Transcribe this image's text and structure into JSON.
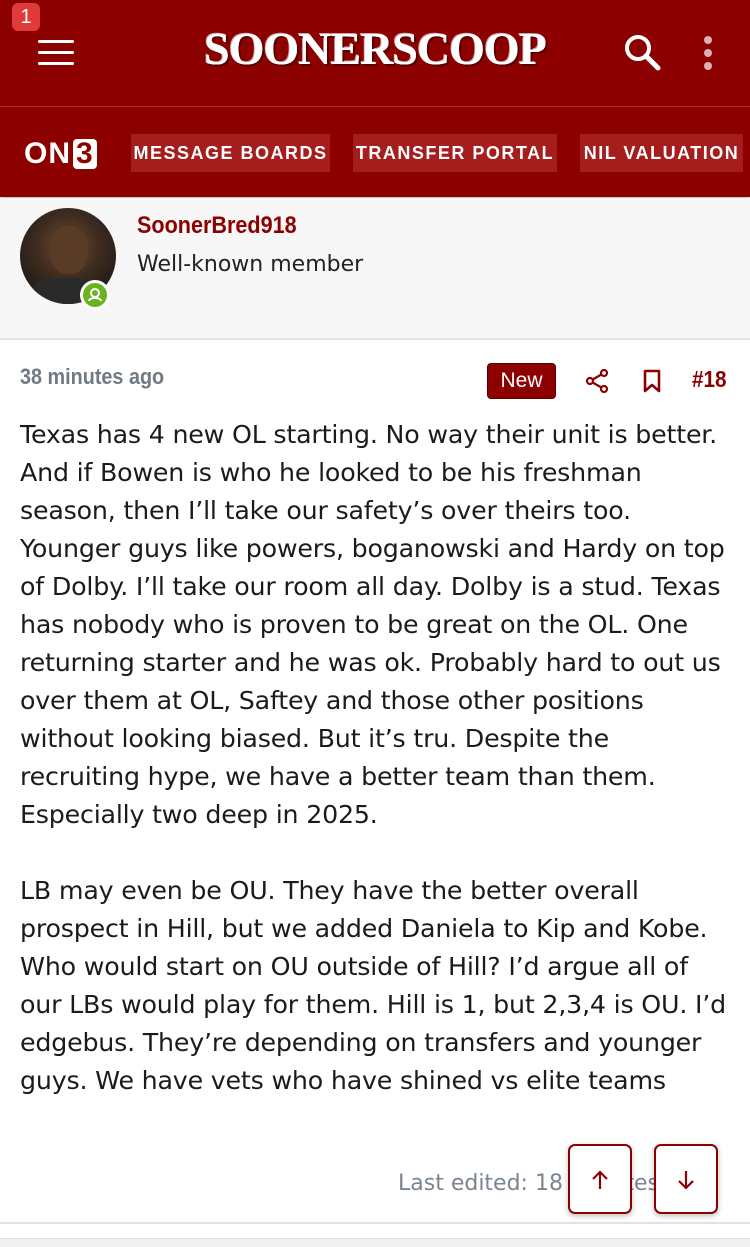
{
  "header": {
    "notification_count": "1",
    "site_name": "SOONERSCOOP"
  },
  "nav": {
    "brand": "ON",
    "brand_suffix": "3",
    "items": [
      {
        "label": "MESSAGE BOARDS"
      },
      {
        "label": "TRANSFER PORTAL"
      },
      {
        "label": "NIL VALUATION"
      }
    ]
  },
  "post": {
    "author": {
      "username": "SoonerBred918",
      "title": "Well-known member",
      "online": true
    },
    "time": "38 minutes ago",
    "new_badge": "New",
    "post_number": "#18",
    "paragraphs": [
      "Texas has 4 new OL starting. No way their unit is better. And if Bowen is who he looked to be his freshman season, then I’ll take our safety’s over theirs too. Younger guys like powers, boganowski and Hardy on top of Dolby. I’ll take our room all day. Dolby is a stud. Texas has nobody who is proven to be great on the OL. One returning starter and he was ok. Probably hard to out us over them at OL, Saftey and those other positions without looking biased. But it’s tru. Despite the recruiting hype, we have a better team than them. Especially two deep in 2025.",
      "LB may even be OU. They have the better overall prospect in Hill, but we added Daniela to Kip and Kobe. Who would start on OU outside of Hill? I’d argue all of our LBs would play for them. Hill is 1, but 2,3,4 is OU. I’d edgebus. They’re depending on transfers and younger guys. We have vets who have shined vs elite teams"
    ],
    "last_edited": "Last edited: 18 minutes ago"
  },
  "colors": {
    "brand": "#8c0000",
    "online": "#6ab21f"
  },
  "icons": [
    "hamburger-icon",
    "search-icon",
    "more-vertical-icon",
    "online-status-icon",
    "share-icon",
    "bookmark-icon",
    "arrow-up-icon",
    "arrow-down-icon"
  ]
}
